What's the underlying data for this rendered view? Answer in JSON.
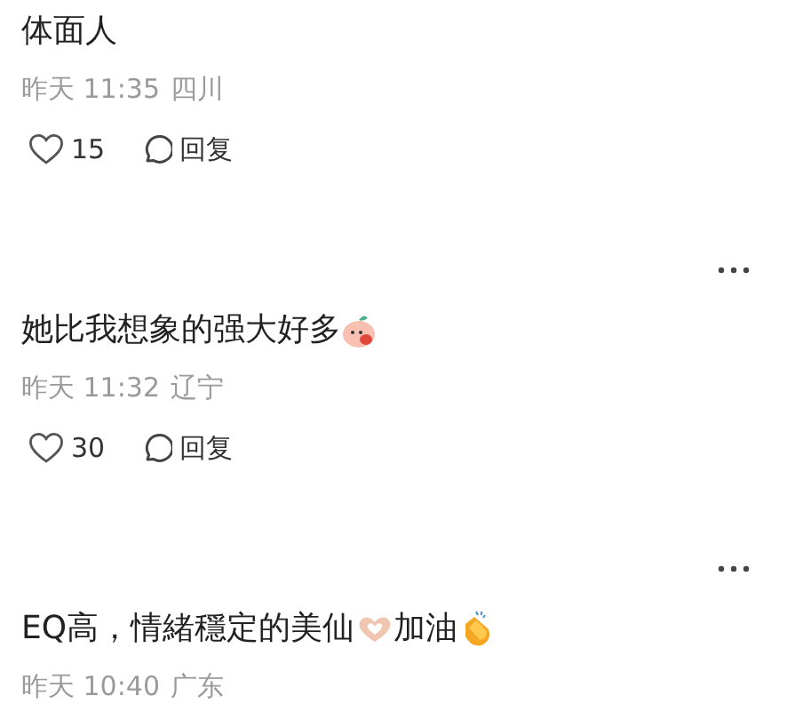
{
  "comments": [
    {
      "has_menu": false,
      "segments": [
        {
          "kind": "text",
          "text": "体面人"
        }
      ],
      "time": "昨天 11:35",
      "location": "四川",
      "likes": "15",
      "reply": "回复"
    },
    {
      "has_menu": true,
      "segments": [
        {
          "kind": "text",
          "text": "她比我想象的强大好多"
        },
        {
          "kind": "peach"
        }
      ],
      "time": "昨天 11:32",
      "location": "辽宁",
      "likes": "30",
      "reply": "回复"
    },
    {
      "has_menu": true,
      "segments": [
        {
          "kind": "text",
          "text": "EQ高，情緒穩定的美仙"
        },
        {
          "kind": "hearthands"
        },
        {
          "kind": "text",
          "text": "加油"
        },
        {
          "kind": "clap"
        }
      ],
      "time": "昨天 10:40",
      "location": "广东"
    }
  ]
}
